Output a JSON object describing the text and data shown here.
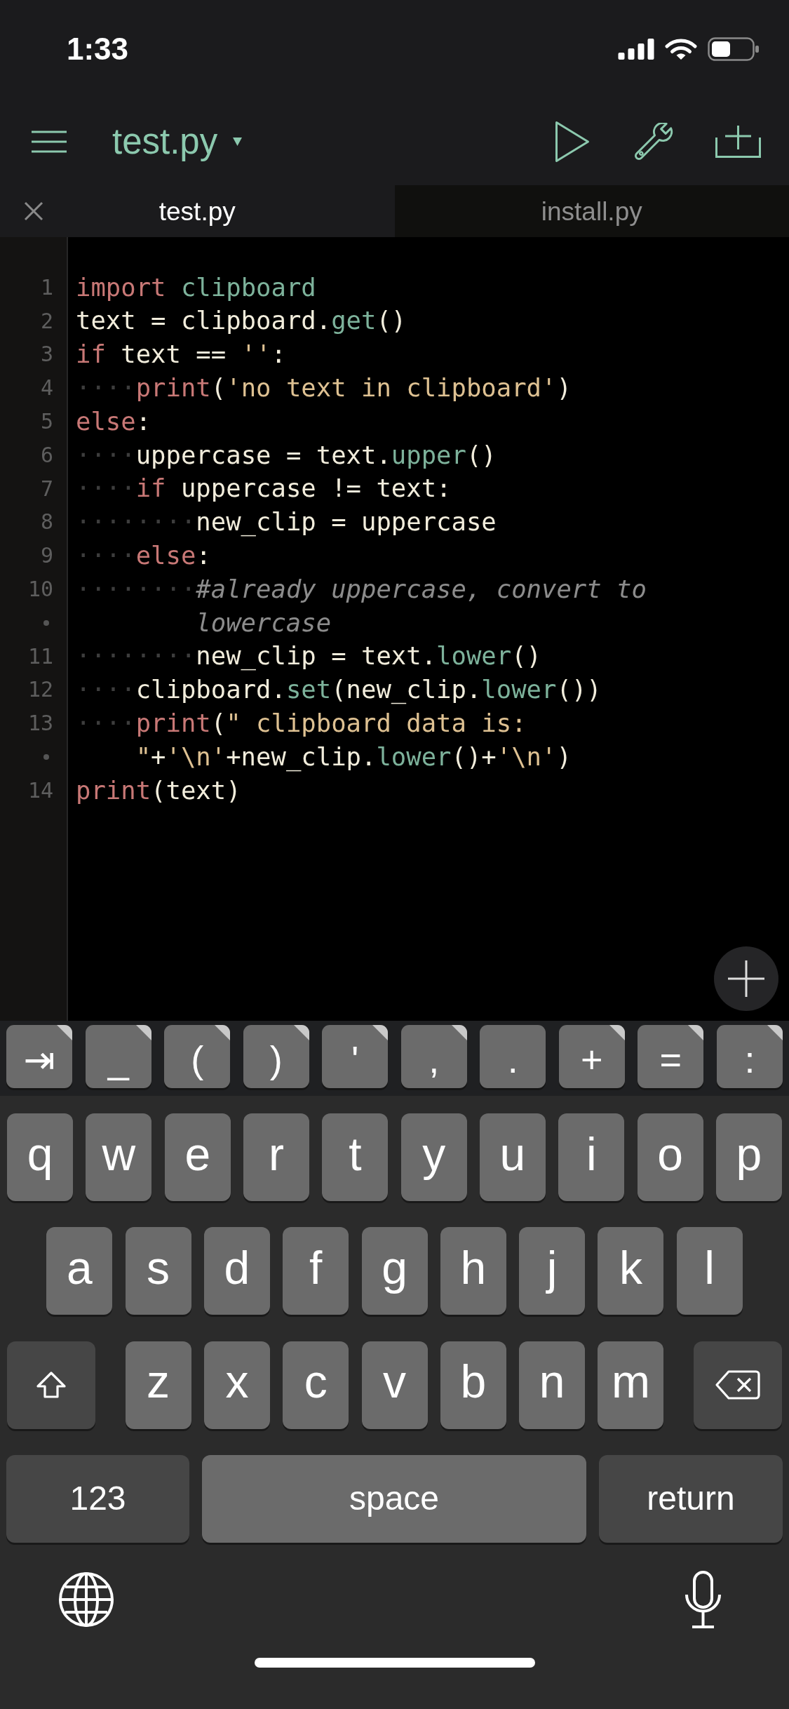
{
  "status_bar": {
    "time": "1:33"
  },
  "toolbar": {
    "title": "test.py"
  },
  "tabs": [
    {
      "label": "test.py",
      "selected": true
    },
    {
      "label": "install.py",
      "selected": false
    }
  ],
  "editor": {
    "rows": [
      {
        "number": "1",
        "continuation": false,
        "segments": [
          {
            "kind": "keyword",
            "text": "import "
          },
          {
            "kind": "name",
            "text": "clipboard"
          }
        ]
      },
      {
        "number": "2",
        "continuation": false,
        "segments": [
          {
            "kind": "plain",
            "text": "text = clipboard."
          },
          {
            "kind": "name",
            "text": "get"
          },
          {
            "kind": "plain",
            "text": "()"
          }
        ]
      },
      {
        "number": "3",
        "continuation": false,
        "segments": [
          {
            "kind": "keyword",
            "text": "if"
          },
          {
            "kind": "plain",
            "text": " text == "
          },
          {
            "kind": "string",
            "text": "''"
          },
          {
            "kind": "plain",
            "text": ":"
          }
        ]
      },
      {
        "number": "4",
        "continuation": false,
        "segments": [
          {
            "kind": "whitespace",
            "text": "····"
          },
          {
            "kind": "keyword",
            "text": "print"
          },
          {
            "kind": "plain",
            "text": "("
          },
          {
            "kind": "string",
            "text": "'no text in clipboard'"
          },
          {
            "kind": "plain",
            "text": ")"
          }
        ]
      },
      {
        "number": "5",
        "continuation": false,
        "segments": [
          {
            "kind": "keyword",
            "text": "else"
          },
          {
            "kind": "plain",
            "text": ":"
          }
        ]
      },
      {
        "number": "6",
        "continuation": false,
        "segments": [
          {
            "kind": "whitespace",
            "text": "····"
          },
          {
            "kind": "plain",
            "text": "uppercase = text."
          },
          {
            "kind": "name",
            "text": "upper"
          },
          {
            "kind": "plain",
            "text": "()"
          }
        ]
      },
      {
        "number": "7",
        "continuation": false,
        "segments": [
          {
            "kind": "whitespace",
            "text": "····"
          },
          {
            "kind": "keyword",
            "text": "if"
          },
          {
            "kind": "plain",
            "text": " uppercase != text:"
          }
        ]
      },
      {
        "number": "8",
        "continuation": false,
        "segments": [
          {
            "kind": "whitespace",
            "text": "········"
          },
          {
            "kind": "plain",
            "text": "new_clip = uppercase"
          }
        ]
      },
      {
        "number": "9",
        "continuation": false,
        "segments": [
          {
            "kind": "whitespace",
            "text": "····"
          },
          {
            "kind": "keyword",
            "text": "else"
          },
          {
            "kind": "plain",
            "text": ":"
          }
        ]
      },
      {
        "number": "10",
        "continuation": false,
        "segments": [
          {
            "kind": "whitespace",
            "text": "········"
          },
          {
            "kind": "comment",
            "text": "#already uppercase, convert to"
          }
        ]
      },
      {
        "continuation": true,
        "segments": [
          {
            "kind": "comment",
            "text": "lowercase"
          }
        ]
      },
      {
        "number": "11",
        "continuation": false,
        "segments": [
          {
            "kind": "whitespace",
            "text": "········"
          },
          {
            "kind": "plain",
            "text": "new_clip = text."
          },
          {
            "kind": "name",
            "text": "lower"
          },
          {
            "kind": "plain",
            "text": "()"
          }
        ]
      },
      {
        "number": "12",
        "continuation": false,
        "segments": [
          {
            "kind": "whitespace",
            "text": "····"
          },
          {
            "kind": "plain",
            "text": "clipboard."
          },
          {
            "kind": "name",
            "text": "set"
          },
          {
            "kind": "plain",
            "text": "(new_clip."
          },
          {
            "kind": "name",
            "text": "lower"
          },
          {
            "kind": "plain",
            "text": "())"
          }
        ]
      },
      {
        "number": "13",
        "continuation": false,
        "segments": [
          {
            "kind": "whitespace",
            "text": "····"
          },
          {
            "kind": "keyword",
            "text": "print"
          },
          {
            "kind": "plain",
            "text": "("
          },
          {
            "kind": "string",
            "text": "\" clipboard data is:"
          }
        ]
      },
      {
        "continuation": true,
        "segments": [
          {
            "kind": "string",
            "text": "\""
          },
          {
            "kind": "plain",
            "text": "+"
          },
          {
            "kind": "string",
            "text": "'\\n'"
          },
          {
            "kind": "plain",
            "text": "+new_clip."
          },
          {
            "kind": "name",
            "text": "lower"
          },
          {
            "kind": "plain",
            "text": "()+"
          },
          {
            "kind": "string",
            "text": "'\\n'"
          },
          {
            "kind": "plain",
            "text": ")"
          }
        ]
      },
      {
        "number": "14",
        "continuation": false,
        "segments": [
          {
            "kind": "keyword",
            "text": "print"
          },
          {
            "kind": "plain",
            "text": "(text)"
          }
        ]
      }
    ]
  },
  "keyboard": {
    "shortcut_keys": [
      {
        "label": "⇥",
        "corner_mark": true
      },
      {
        "label": "_",
        "corner_mark": true
      },
      {
        "label": "(",
        "corner_mark": true
      },
      {
        "label": ")",
        "corner_mark": true
      },
      {
        "label": "'",
        "corner_mark": true
      },
      {
        "label": ",",
        "corner_mark": true
      },
      {
        "label": ".",
        "corner_mark": false
      },
      {
        "label": "+",
        "corner_mark": true
      },
      {
        "label": "=",
        "corner_mark": true
      },
      {
        "label": ":",
        "corner_mark": true
      }
    ],
    "rows": [
      {
        "keys": [
          {
            "kind": "letter",
            "label": "q"
          },
          {
            "kind": "letter",
            "label": "w"
          },
          {
            "kind": "letter",
            "label": "e"
          },
          {
            "kind": "letter",
            "label": "r"
          },
          {
            "kind": "letter",
            "label": "t"
          },
          {
            "kind": "letter",
            "label": "y"
          },
          {
            "kind": "letter",
            "label": "u"
          },
          {
            "kind": "letter",
            "label": "i"
          },
          {
            "kind": "letter",
            "label": "o"
          },
          {
            "kind": "letter",
            "label": "p"
          }
        ]
      },
      {
        "keys": [
          {
            "kind": "letter",
            "label": "a"
          },
          {
            "kind": "letter",
            "label": "s"
          },
          {
            "kind": "letter",
            "label": "d"
          },
          {
            "kind": "letter",
            "label": "f"
          },
          {
            "kind": "letter",
            "label": "g"
          },
          {
            "kind": "letter",
            "label": "h"
          },
          {
            "kind": "letter",
            "label": "j"
          },
          {
            "kind": "letter",
            "label": "k"
          },
          {
            "kind": "letter",
            "label": "l"
          }
        ]
      },
      {
        "keys": [
          {
            "kind": "shift"
          },
          {
            "kind": "letter",
            "label": "z"
          },
          {
            "kind": "letter",
            "label": "x"
          },
          {
            "kind": "letter",
            "label": "c"
          },
          {
            "kind": "letter",
            "label": "v"
          },
          {
            "kind": "letter",
            "label": "b"
          },
          {
            "kind": "letter",
            "label": "n"
          },
          {
            "kind": "letter",
            "label": "m"
          },
          {
            "kind": "backspace"
          }
        ]
      },
      {
        "keys": [
          {
            "kind": "mode",
            "label": "123"
          },
          {
            "kind": "space",
            "label": "space"
          },
          {
            "kind": "return",
            "label": "return"
          }
        ]
      }
    ]
  }
}
